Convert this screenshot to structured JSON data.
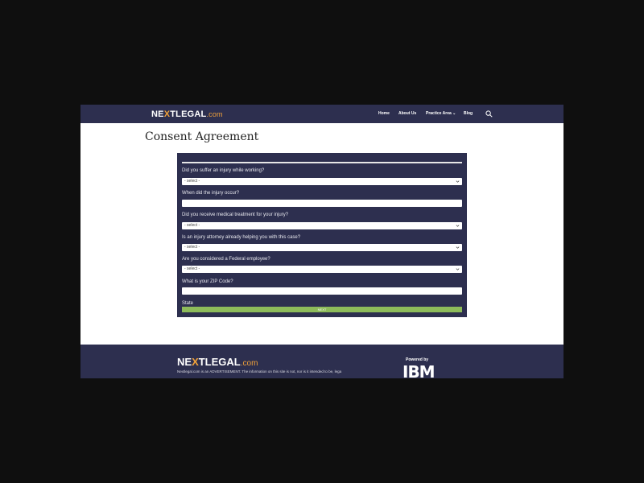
{
  "header": {
    "logo_pre": "NE",
    "logo_x": "X",
    "logo_post": "TLEGAL",
    "logo_domain": ".com",
    "nav": {
      "home": "Home",
      "about": "About Us",
      "practice": "Practice Area",
      "blog": "Blog"
    }
  },
  "page": {
    "title": "Consent Agreement"
  },
  "form": {
    "questions": [
      {
        "label": "Did you suffer an injury while working?",
        "type": "select",
        "value": "- select -"
      },
      {
        "label": "When did the injury occur?",
        "type": "text",
        "value": ""
      },
      {
        "label": "Did you receive medical treatment for your injury?",
        "type": "select",
        "value": "- select -"
      },
      {
        "label": "Is an injury attorney already helping you with this case?",
        "type": "select",
        "value": "- select -"
      },
      {
        "label": "Are you considered a Federal employee?",
        "type": "select",
        "value": "- select -"
      },
      {
        "label": "What is your ZIP Code?",
        "type": "text",
        "value": ""
      },
      {
        "label": "State",
        "type": "label"
      }
    ],
    "submit_label": "NEXT"
  },
  "footer": {
    "logo_pre": "NE",
    "logo_x": "X",
    "logo_post": "TLEGAL",
    "logo_domain": ".com",
    "disclaimer": "Nextlegal.com is an ADVERTISEMENT. The information on this site is not, nor is it intended to be, lega",
    "powered_by": "Powered by",
    "partner_logo": "IBM"
  },
  "colors": {
    "navy": "#2d2f4f",
    "accent": "#f0a13a",
    "submit": "#8dbb5a"
  }
}
